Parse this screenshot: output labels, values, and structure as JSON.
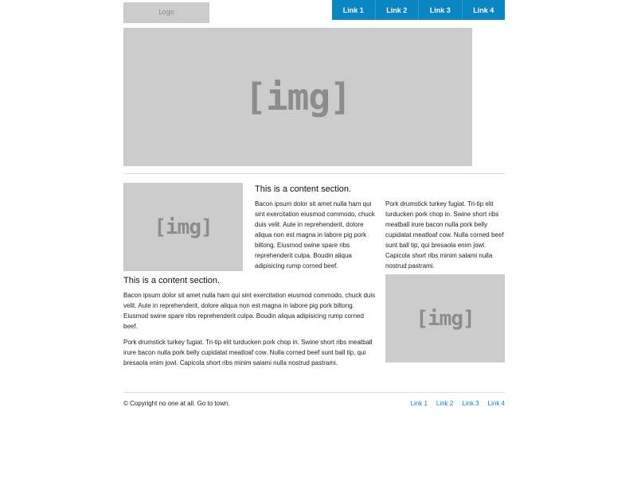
{
  "header": {
    "logo_text": "Logo",
    "nav": [
      {
        "label": "Link 1"
      },
      {
        "label": "Link 2"
      },
      {
        "label": "Link 3"
      },
      {
        "label": "Link 4"
      }
    ]
  },
  "hero": {
    "image_label": "[img]"
  },
  "content": {
    "section1": {
      "image_label": "[img]",
      "heading": "This is a content section.",
      "paragraph": "Bacon ipsum dolor sit amet nulla ham qui sint exercitation eiusmod commodo, chuck duis velit. Aute in reprehenderit, dolore aliqua non est magna in labore pig pork biltong. Eiusmod swine spare ribs reprehenderit culpa. Boudin aliqua adipisicing rump corned beef."
    },
    "side_paragraph": "Pork drumstick turkey fugiat. Tri-tip elit turducken pork chop in. Swine short ribs meatball irure bacon nulla pork belly cupidatat meatloaf cow. Nulla corned beef sunt ball tip, qui bresaola enim jowl. Capicola short ribs minim salami nulla nostrud pastrami.",
    "section2": {
      "heading": "This is a content section.",
      "paragraph1": "Bacon ipsum dolor sit amet nulla ham qui sint exercitation eiusmod commodo, chuck duis velit. Aute in reprehenderit, dolore aliqua non est magna in labore pig pork biltong. Eiusmod swine spare ribs reprehenderit culpa. Boudin aliqua adipisicing rump corned beef.",
      "paragraph2": "Pork drumstick turkey fugiat. Tri-tip elit turducken pork chop in. Swine short ribs meatball irure bacon nulla pork belly cupidatat meatloaf cow. Nulla corned beef sunt ball tip, qui bresaola enim jowl. Capicola short ribs minim salami nulla nostrud pastrami.",
      "image_label": "[img]"
    }
  },
  "footer": {
    "copyright": "© Copyright no one at all. Go to town.",
    "links": [
      {
        "label": "Link 1"
      },
      {
        "label": "Link 2"
      },
      {
        "label": "Link 3"
      },
      {
        "label": "Link 4"
      }
    ]
  },
  "colors": {
    "accent": "#0a87c2",
    "placeholder": "#cccccc",
    "placeholder_text": "#8c8c8c",
    "rule": "#dcdcdc"
  }
}
